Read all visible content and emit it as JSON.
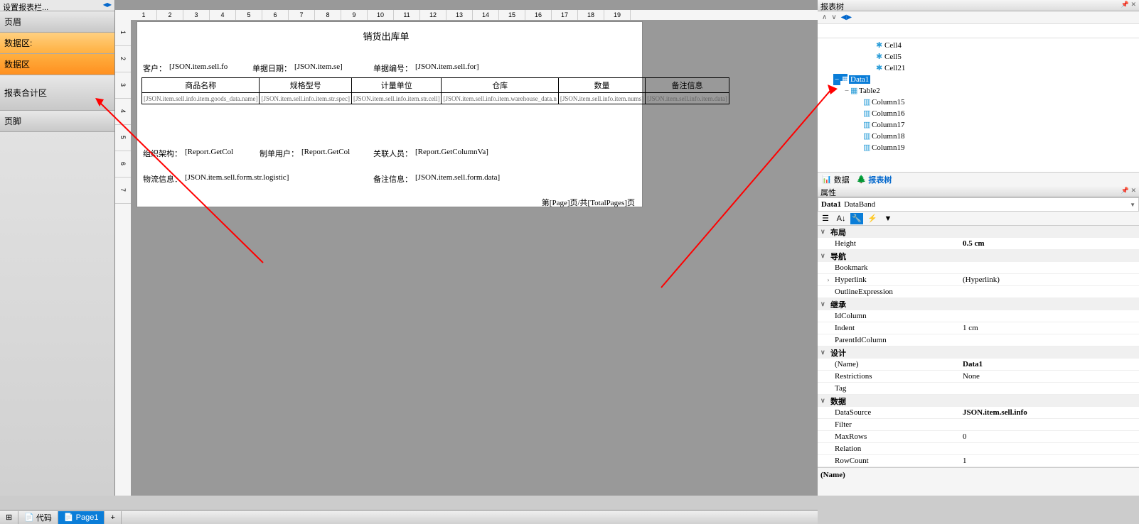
{
  "leftPanel": {
    "header": "设置报表栏...",
    "sections": [
      {
        "label": "页眉",
        "type": "normal"
      },
      {
        "label": "数据区:",
        "type": "data-area"
      },
      {
        "label": "数据区",
        "type": "selected"
      },
      {
        "label": "报表合计区",
        "type": "tall"
      },
      {
        "label": "页脚",
        "type": "normal"
      }
    ]
  },
  "report": {
    "title": "销货出库单",
    "customerLabel": "客户：",
    "customer": "[JSON.item.sell.fo",
    "dateLabel": "单据日期：",
    "date": "[JSON.item.se]",
    "noLabel": "单据编号：",
    "no": "[JSON.item.sell.for]",
    "tableHeaders": [
      "商品名称",
      "规格型号",
      "计量单位",
      "仓库",
      "数量",
      "备注信息"
    ],
    "tableData": [
      "[JSON.item.sell.info.item.goods_data.name]",
      "[JSON.item.sell.info.item.str.spec]",
      "[JSON.item.sell.info.item.str.cell]",
      "[JSON.item.sell.info.item.warehouse_data.n",
      "[JSON.item.sell.info.item.nums]",
      "[JSON.item.sell.info.item.data]"
    ],
    "orgLabel": "组织架构：",
    "org": "[Report.GetCol",
    "userLabel": "制单用户：",
    "user": "[Report.GetCol",
    "relLabel": "关联人员：",
    "rel": "[Report.GetColumnVa]",
    "logisticLabel": "物流信息：",
    "logistic": "[JSON.item.sell.form.str.logistic]",
    "remarkLabel": "备注信息：",
    "remark": "[JSON.item.sell.form.data]",
    "pageInfo": "第[Page]页/共[TotalPages]页"
  },
  "treePanel": {
    "title": "报表树",
    "nodes": [
      {
        "indent": 80,
        "icon": "cell",
        "label": "Cell4"
      },
      {
        "indent": 80,
        "icon": "cell",
        "label": "Cell5"
      },
      {
        "indent": 80,
        "icon": "cell",
        "label": "Cell21"
      },
      {
        "indent": 20,
        "icon": "data",
        "label": "Data1",
        "selected": true,
        "expander": "−"
      },
      {
        "indent": 34,
        "icon": "table",
        "label": "Table2",
        "expander": "−"
      },
      {
        "indent": 62,
        "icon": "col",
        "label": "Column15"
      },
      {
        "indent": 62,
        "icon": "col",
        "label": "Column16"
      },
      {
        "indent": 62,
        "icon": "col",
        "label": "Column17"
      },
      {
        "indent": 62,
        "icon": "col",
        "label": "Column18"
      },
      {
        "indent": 62,
        "icon": "col",
        "label": "Column19"
      }
    ],
    "tabs": [
      {
        "label": "数据",
        "icon": "📊"
      },
      {
        "label": "报表树",
        "icon": "🌲",
        "active": true
      }
    ]
  },
  "propPanel": {
    "title": "属性",
    "objectName": "Data1",
    "objectType": "DataBand",
    "categories": [
      {
        "name": "布局",
        "rows": [
          {
            "k": "Height",
            "v": "0.5 cm",
            "bold": true
          }
        ]
      },
      {
        "name": "导航",
        "rows": [
          {
            "k": "Bookmark",
            "v": ""
          },
          {
            "k": "Hyperlink",
            "v": "(Hyperlink)",
            "exp": true
          },
          {
            "k": "OutlineExpression",
            "v": ""
          }
        ]
      },
      {
        "name": "继承",
        "rows": [
          {
            "k": "IdColumn",
            "v": ""
          },
          {
            "k": "Indent",
            "v": "1 cm"
          },
          {
            "k": "ParentIdColumn",
            "v": ""
          }
        ]
      },
      {
        "name": "设计",
        "rows": [
          {
            "k": "(Name)",
            "v": "Data1",
            "bold": true
          },
          {
            "k": "Restrictions",
            "v": "None"
          },
          {
            "k": "Tag",
            "v": ""
          }
        ]
      },
      {
        "name": "数据",
        "rows": [
          {
            "k": "DataSource",
            "v": "JSON.item.sell.info",
            "bold": true
          },
          {
            "k": "Filter",
            "v": ""
          },
          {
            "k": "MaxRows",
            "v": "0"
          },
          {
            "k": "Relation",
            "v": ""
          },
          {
            "k": "RowCount",
            "v": "1"
          }
        ]
      }
    ],
    "descLabel": "(Name)"
  },
  "bottomBar": {
    "code": "代码",
    "page": "Page1"
  },
  "ruler": {
    "marks": 19
  }
}
